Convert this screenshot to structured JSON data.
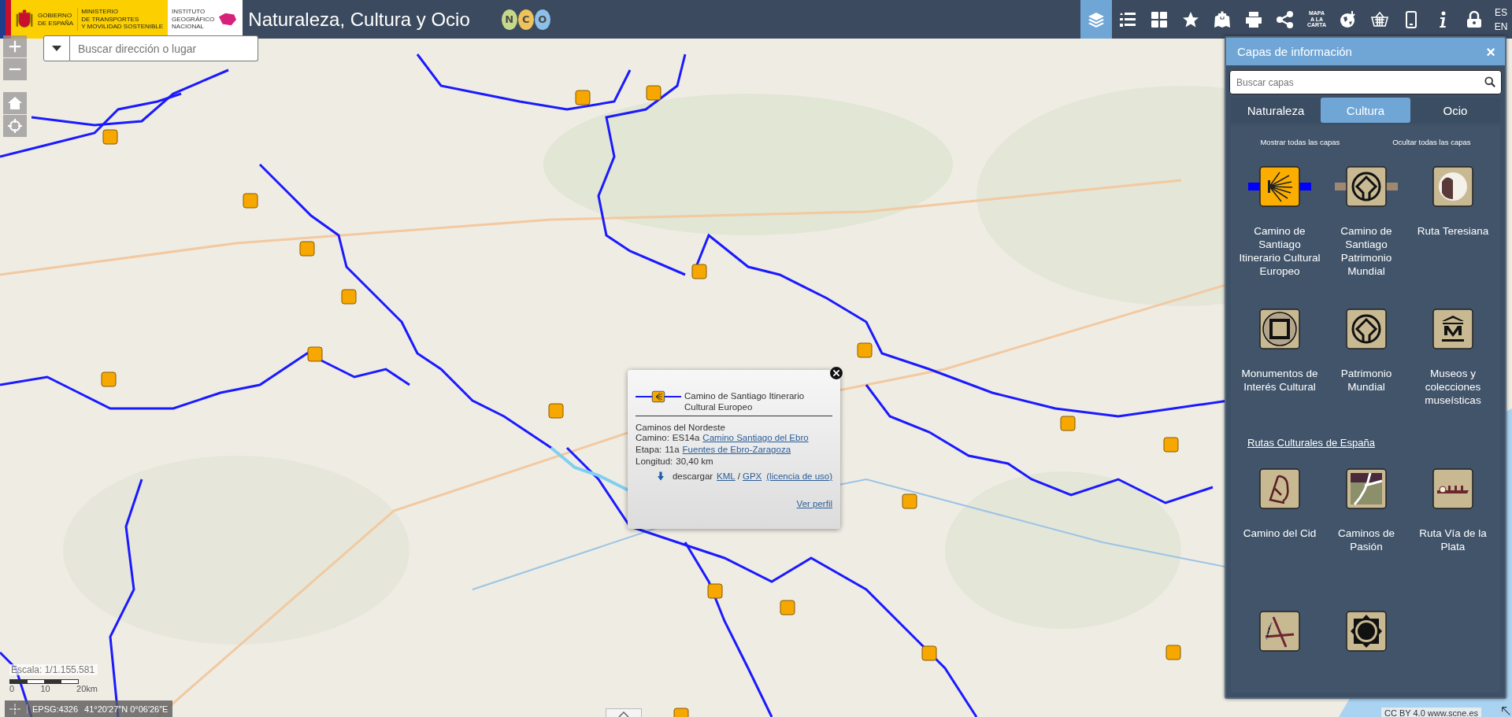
{
  "header": {
    "gov_logo": {
      "lines": [
        "GOBIERNO",
        "DE ESPAÑA"
      ]
    },
    "ministry_logo": {
      "lines": [
        "MINISTERIO",
        "DE TRANSPORTES",
        "Y MOVILIDAD SOSTENIBLE"
      ]
    },
    "ign_logo": {
      "lines": [
        "INSTITUTO",
        "GEOGRÁFICO",
        "NACIONAL"
      ]
    },
    "title": "Naturaleza, Cultura y Ocio",
    "app_logo_letters": [
      "N",
      "C",
      "O"
    ]
  },
  "toolbar": {
    "tools": [
      {
        "kind": "layers",
        "selected": true
      },
      {
        "kind": "legend",
        "selected": false
      },
      {
        "kind": "grid",
        "selected": false
      },
      {
        "kind": "favorites",
        "selected": false
      },
      {
        "kind": "add-map",
        "selected": false
      },
      {
        "kind": "print",
        "selected": false
      },
      {
        "kind": "share",
        "selected": false
      },
      {
        "kind": "text",
        "lines": [
          "MAPA",
          "A LA",
          "CARTA"
        ],
        "selected": false
      },
      {
        "kind": "download",
        "selected": false
      },
      {
        "kind": "basket",
        "selected": false
      },
      {
        "kind": "mobile",
        "selected": false
      },
      {
        "kind": "info",
        "selected": false
      },
      {
        "kind": "lock",
        "selected": false
      }
    ],
    "languages": [
      "ES",
      "EN"
    ]
  },
  "search": {
    "placeholder": "Buscar dirección o lugar"
  },
  "panel": {
    "title": "Capas de información",
    "close": "×",
    "search_placeholder": "Buscar capas",
    "tabs": [
      {
        "label": "Naturaleza",
        "selected": false
      },
      {
        "label": "Cultura",
        "selected": true
      },
      {
        "label": "Ocio",
        "selected": false
      }
    ],
    "actions": [
      "Mostrar todas las capas",
      "Ocultar todas las capas"
    ],
    "groups": [
      {
        "layers": [
          {
            "kind": "shell",
            "label": "Camino de Santiago Itinerario Cultural Europeo"
          },
          {
            "kind": "heritage-route",
            "label": "Camino de Santiago Patrimonio Mundial"
          },
          {
            "kind": "teresa",
            "label": "Ruta Teresiana"
          },
          {
            "kind": "monument",
            "label": "Monumentos de Interés Cultural"
          },
          {
            "kind": "heritage",
            "label": "Patrimonio Mundial"
          },
          {
            "kind": "museum",
            "label": "Museos y colecciones museísticas"
          }
        ]
      },
      {
        "title": "Rutas Culturales de España",
        "layers": [
          {
            "kind": "cid",
            "label": "Camino del Cid"
          },
          {
            "kind": "pasion",
            "label": "Caminos de Pasión"
          },
          {
            "kind": "plata",
            "label": "Ruta Vía de la Plata"
          },
          {
            "kind": "cross"
          },
          {
            "kind": "sun"
          }
        ]
      }
    ]
  },
  "popup": {
    "title": "Camino de Santiago Itinerario Cultural Europeo",
    "subtitle": "Caminos del Nordeste",
    "fields": [
      {
        "label": "Camino:",
        "value": "ES14a",
        "link": "Camino Santiago del Ebro"
      },
      {
        "label": "Etapa:",
        "value": "11a",
        "link": "Fuentes de Ebro-Zaragoza"
      },
      {
        "label": "Longitud:",
        "value": "30,40 km"
      }
    ],
    "download": {
      "text": "descargar",
      "links": [
        "KML",
        "GPX"
      ],
      "separator": "/",
      "license": "(licencia de uso)"
    },
    "profile_link": "Ver perfil"
  },
  "scale": {
    "text": "Escala: 1/1.155.581",
    "ticks": [
      "0",
      "10",
      "20km"
    ]
  },
  "coordinates": {
    "projection": "EPSG:4326",
    "position": "41°20′27″N 0°06′26″E"
  },
  "attribution": "CC BY 4.0 www.scne.es"
}
